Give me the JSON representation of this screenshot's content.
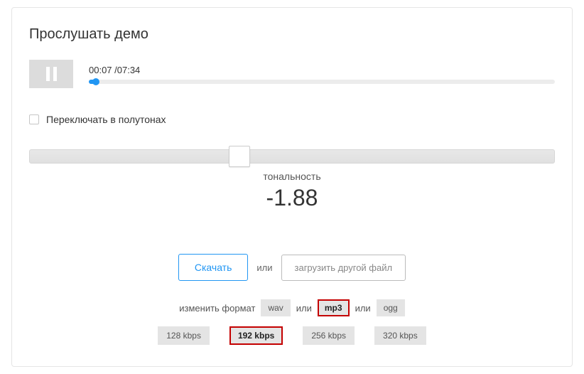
{
  "title": "Прослушать демо",
  "player": {
    "time_display": "00:07 /07:34",
    "progress_percent": 1.6
  },
  "semitones": {
    "label": "Переключать в полутонах",
    "checked": false
  },
  "tone": {
    "label": "тональность",
    "value": "-1.88",
    "slider_percent": 40
  },
  "actions": {
    "download": "Скачать",
    "or": "или",
    "upload": "загрузить другой файл"
  },
  "format": {
    "change_label": "изменить формат",
    "options": [
      "wav",
      "mp3",
      "ogg"
    ],
    "separator": "или",
    "selected": "mp3"
  },
  "bitrate": {
    "options": [
      "128 kbps",
      "192 kbps",
      "256 kbps",
      "320 kbps"
    ],
    "selected": "192 kbps"
  }
}
